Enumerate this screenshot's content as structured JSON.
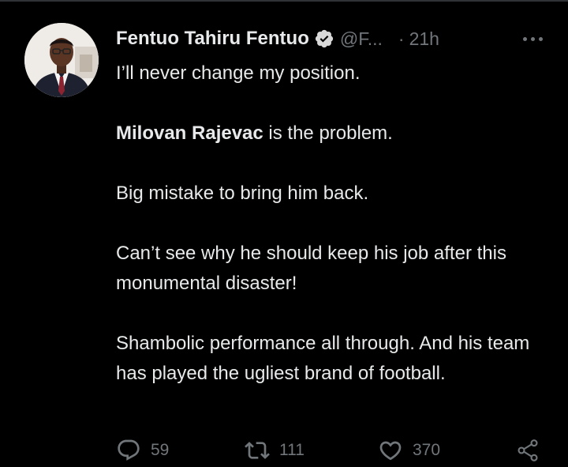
{
  "colors": {
    "background": "#000000",
    "text_primary": "#e7e9ea",
    "text_secondary": "#71767b",
    "verified_badge": "#d9d9d9",
    "divider": "#2f3336"
  },
  "tweet": {
    "author": {
      "display_name": "Fentuo Tahiru Fentuo",
      "handle": "@F...",
      "verified_icon": "verified-badge-icon",
      "avatar_icon": "profile-avatar"
    },
    "time_separator": "·",
    "time": "21h",
    "more_icon": "more-horizontal-icon",
    "body": {
      "line1": "I’ll never change my position.",
      "line2_bold": "Milovan Rajevac",
      "line2_rest": " is the problem.",
      "line3": "Big mistake to bring him back.",
      "line4": "Can’t see why he should keep his job after this monumental disaster!",
      "line5": "Shambolic performance all through. And his team has played the ugliest brand of football."
    },
    "actions": {
      "reply_icon": "reply-icon",
      "reply_count": "59",
      "retweet_icon": "retweet-icon",
      "retweet_count": "111",
      "like_icon": "heart-icon",
      "like_count": "370",
      "share_icon": "share-icon"
    }
  }
}
